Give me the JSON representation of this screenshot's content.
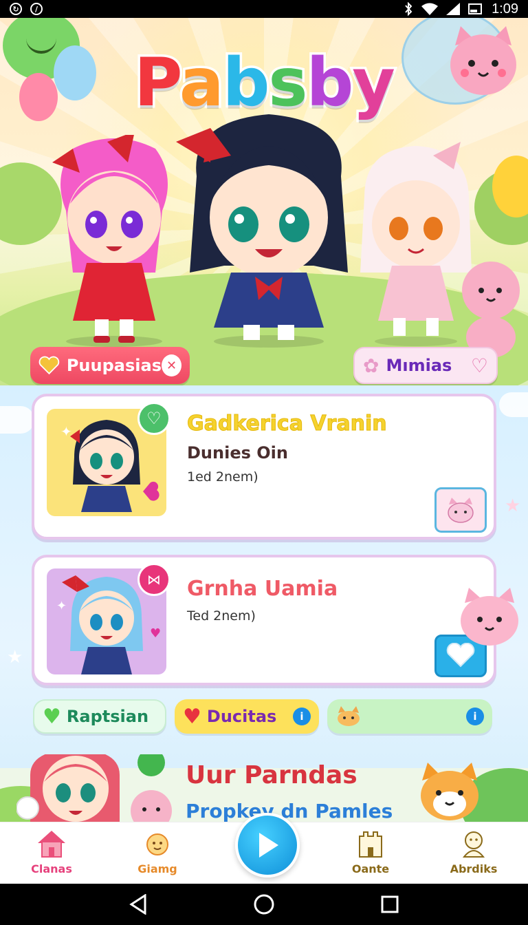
{
  "status_bar": {
    "time": "1:09"
  },
  "app": {
    "logo_letters": [
      "P",
      "a",
      "b",
      "s",
      "b",
      "y"
    ],
    "logo_colors": [
      "#f2373f",
      "#ff9a2e",
      "#2bb8e8",
      "#4dc25b",
      "#b545d6",
      "#e2409a"
    ]
  },
  "hero_tags": {
    "left": {
      "label": "Puupasias",
      "icon": "heart-icon",
      "action_icon": "close-icon"
    },
    "right": {
      "label": "Mımias",
      "icon": "flower-icon",
      "action_icon": "heart-icon"
    }
  },
  "cards": [
    {
      "title": "Gadkerica Vranin",
      "title_color": "#f5d22e",
      "subtitle": "Dunies Oin",
      "meta": "1ed 2nem)",
      "badge_icon": "heart-icon",
      "action_icon": "cat-icon"
    },
    {
      "title": "Grnha Uamia",
      "title_color": "#ef5a66",
      "meta": "Ted 2nem)",
      "badge_icon": "bow-icon",
      "action_icon": "heart-icon"
    }
  ],
  "chips": [
    {
      "label": "Raptsian",
      "icon": "heart-icon"
    },
    {
      "label": "Ducitas",
      "icon": "heart-icon",
      "info": "i"
    },
    {
      "label": "",
      "icon": "cat-icon",
      "info": "i"
    }
  ],
  "promo": {
    "title": "Uur Parndas",
    "subtitle": "Propkey dn Pamles"
  },
  "bottom_nav": [
    {
      "label": "Clanas",
      "icon": "home-icon",
      "color": "#e6417c"
    },
    {
      "label": "Giamg",
      "icon": "sun-icon",
      "color": "#e68a2a"
    },
    {
      "label": "Oante",
      "icon": "castle-icon",
      "color": "#8a6a1a"
    },
    {
      "label": "Abrdiks",
      "icon": "character-icon",
      "color": "#8a6a1a"
    }
  ],
  "colors": {
    "accent_blue": "#1a9ee6",
    "accent_red": "#ee4862",
    "card_border": "#e6c6ec"
  }
}
